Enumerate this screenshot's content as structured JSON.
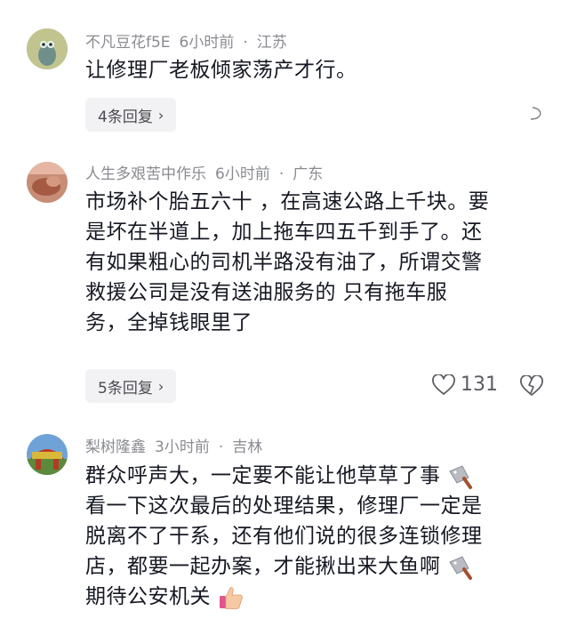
{
  "comments": [
    {
      "username": "不凡豆花f5E",
      "time": "6小时前",
      "location": "江苏",
      "text": "让修理厂老板倾家荡产才行。",
      "reply_label": "4条回复"
    },
    {
      "username": "人生多艰苦中作乐",
      "time": "6小时前",
      "location": "广东",
      "lines": [
        "市场补个胎五六十 ，在高速公路上千块。要",
        "是坏在半道上，加上拖车四五千到手了。还",
        "有如果粗心的司机半路没有油了，所谓交警",
        "救援公司是没有送油服务的 只有拖车服",
        "务，全掉钱眼里了"
      ],
      "reply_label": "5条回复",
      "like_count": "131"
    },
    {
      "username": "梨树隆鑫",
      "time": "3小时前",
      "location": "吉林",
      "lines": [
        "群众呼声大，一定要不能让他草草了事",
        "看一下这次最后的处理结果，修理厂一定是",
        "脱离不了干系，还有他们说的很多连锁修理",
        "店，都要一起办案，才能揪出来大鱼啊",
        "期待公安机关"
      ]
    }
  ],
  "separator": "·",
  "chevron": "›",
  "icons": [
    "cleaver-emoji",
    "thumbs-up-emoji",
    "heart-outline-icon",
    "broken-heart-icon",
    "chevron-right-icon"
  ]
}
